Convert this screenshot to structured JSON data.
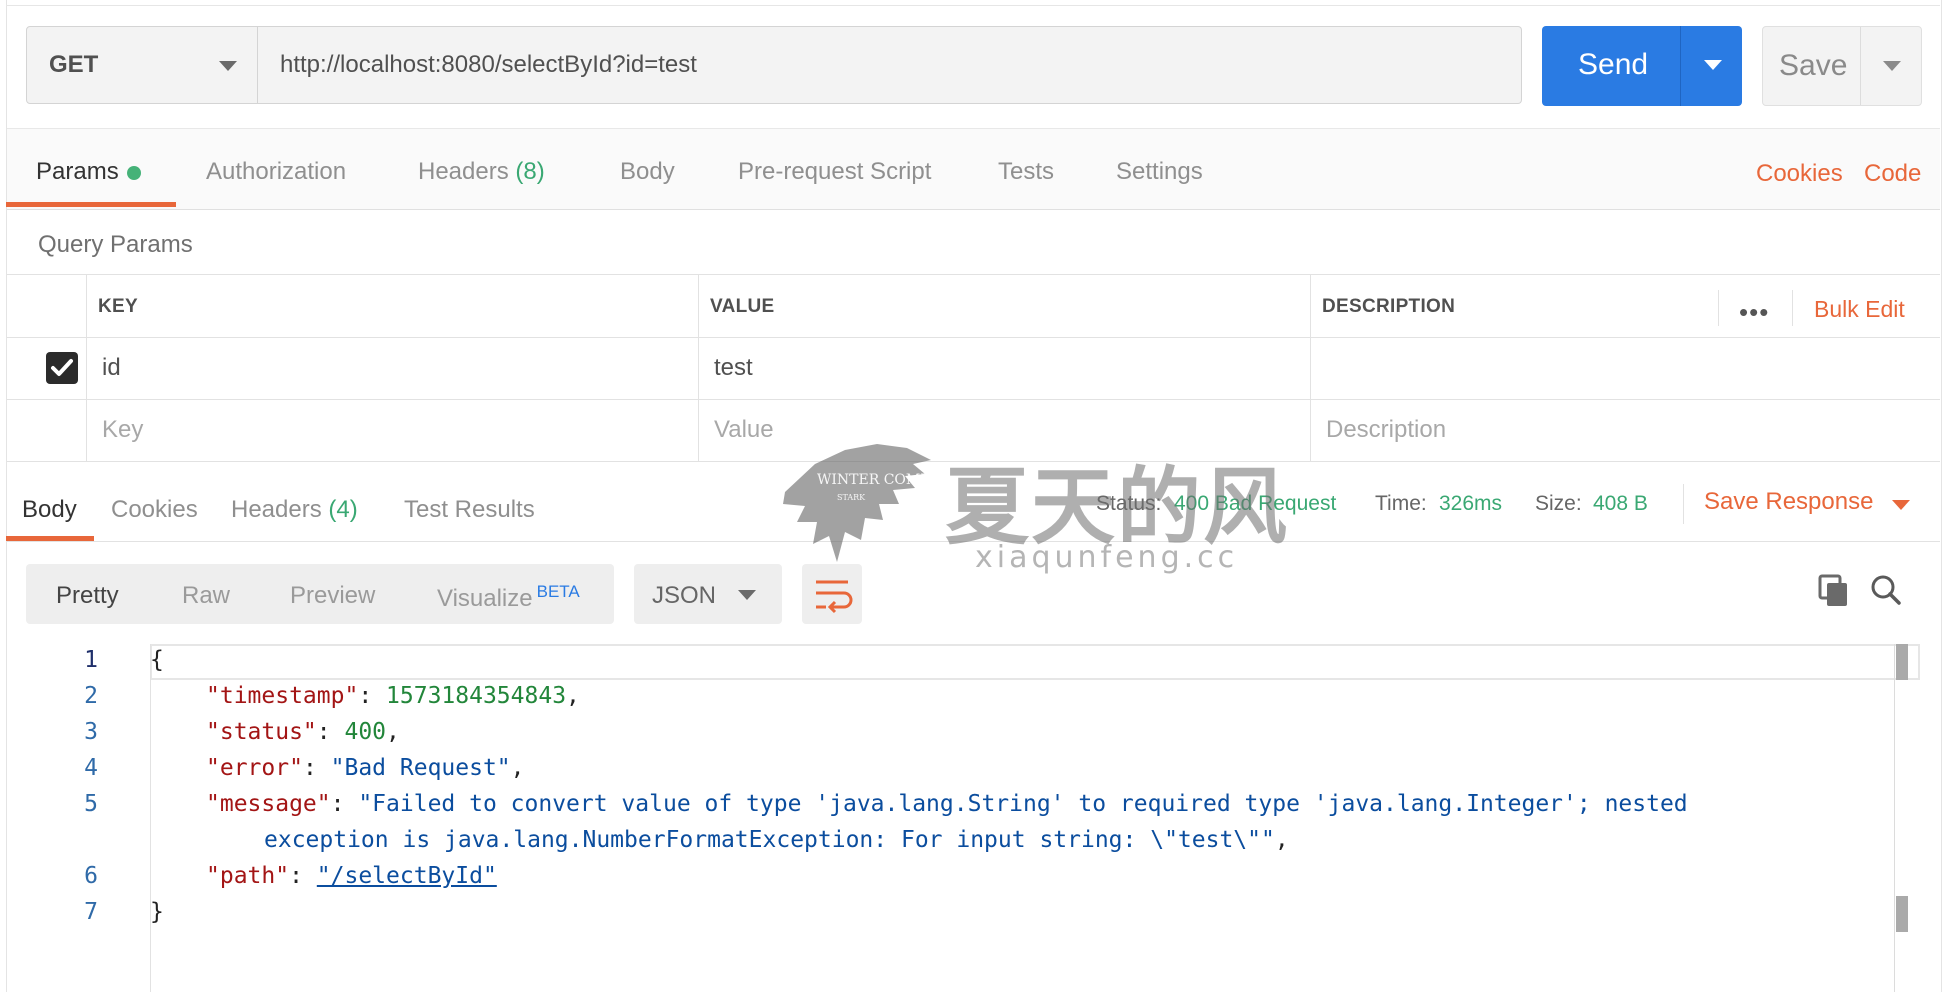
{
  "request": {
    "method": "GET",
    "url": "http://localhost:8080/selectById?id=test",
    "send_label": "Send",
    "save_label": "Save"
  },
  "request_tabs": {
    "params": "Params",
    "authorization": "Authorization",
    "headers": "Headers",
    "headers_count": "(8)",
    "body": "Body",
    "prerequest": "Pre-request Script",
    "tests": "Tests",
    "settings": "Settings",
    "cookies": "Cookies",
    "code": "Code"
  },
  "query_params": {
    "title": "Query Params",
    "columns": {
      "key": "KEY",
      "value": "VALUE",
      "description": "DESCRIPTION"
    },
    "bulk_edit": "Bulk Edit",
    "rows": [
      {
        "key": "id",
        "value": "test",
        "description": ""
      }
    ],
    "placeholders": {
      "key": "Key",
      "value": "Value",
      "description": "Description"
    }
  },
  "response_tabs": {
    "body": "Body",
    "cookies": "Cookies",
    "headers": "Headers",
    "headers_count": "(4)",
    "test_results": "Test Results"
  },
  "response_status": {
    "status_label": "Status:",
    "status_value": "400 Bad Request",
    "time_label": "Time:",
    "time_value": "326ms",
    "size_label": "Size:",
    "size_value": "408 B",
    "save_response": "Save Response"
  },
  "viewer": {
    "pretty": "Pretty",
    "raw": "Raw",
    "preview": "Preview",
    "visualize": "Visualize",
    "beta": "BETA",
    "format": "JSON"
  },
  "code_lines": [
    {
      "n": "1",
      "text": "{"
    },
    {
      "n": "2",
      "key": "\"timestamp\"",
      "val": "1573184354843",
      "type": "n",
      "tail": ","
    },
    {
      "n": "3",
      "key": "\"status\"",
      "val": "400",
      "type": "n",
      "tail": ","
    },
    {
      "n": "4",
      "key": "\"error\"",
      "val": "\"Bad Request\"",
      "type": "s",
      "tail": ","
    },
    {
      "n": "5",
      "key": "\"message\"",
      "val": "\"Failed to convert value of type 'java.lang.String' to required type 'java.lang.Integer'; nested",
      "type": "s",
      "tail": ""
    },
    {
      "n": "",
      "cont": "exception is java.lang.NumberFormatException: For input string: \\\"test\\\"\"",
      "tail": ","
    },
    {
      "n": "6",
      "key": "\"path\"",
      "val": "\"/selectById\"",
      "type": "link",
      "tail": ""
    },
    {
      "n": "7",
      "text": "}"
    }
  ],
  "watermark": {
    "badge": "WINTER COMING",
    "badge_small": "STARK",
    "cn": "夏天的风",
    "url": "xiaqunfeng.cc"
  }
}
